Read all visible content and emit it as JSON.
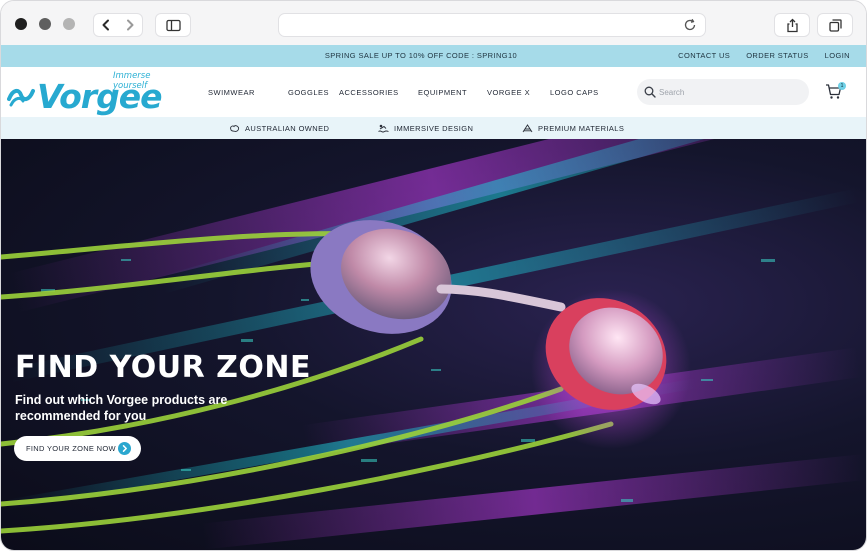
{
  "browser": {
    "back_icon": "chevron-left-icon",
    "forward_icon": "chevron-right-icon",
    "sidebar_icon": "sidebar-icon",
    "reload_icon": "reload-icon",
    "share_icon": "share-icon",
    "tabs_icon": "tabs-icon"
  },
  "promo": {
    "text": "SPRING SALE UP TO 10% OFF CODE : SPRING10",
    "links": [
      "CONTACT US",
      "ORDER STATUS",
      "LOGIN"
    ],
    "background": "#a6dbe9"
  },
  "header": {
    "logo_text": "Vorgee",
    "logo_tagline": "Immerse yourself",
    "nav": [
      "SWIMWEAR",
      "GOGGLES",
      "ACCESSORIES",
      "EQUIPMENT",
      "VORGEE X",
      "LOGO CAPS"
    ],
    "search_placeholder": "Search",
    "cart_count": "1",
    "brand_color": "#27a9d0"
  },
  "features": [
    {
      "icon": "australia-map-icon",
      "label": "AUSTRALIAN OWNED"
    },
    {
      "icon": "swimmer-icon",
      "label": "IMMERSIVE DESIGN"
    },
    {
      "icon": "fabric-icon",
      "label": "PREMIUM MATERIALS"
    }
  ],
  "hero": {
    "title": "FIND YOUR ZONE",
    "subtitle": "Find out which Vorgee products are recommended for you",
    "button_label": "FIND YOUR ZONE NOW",
    "button_icon": "arrow-right-circle-icon"
  }
}
